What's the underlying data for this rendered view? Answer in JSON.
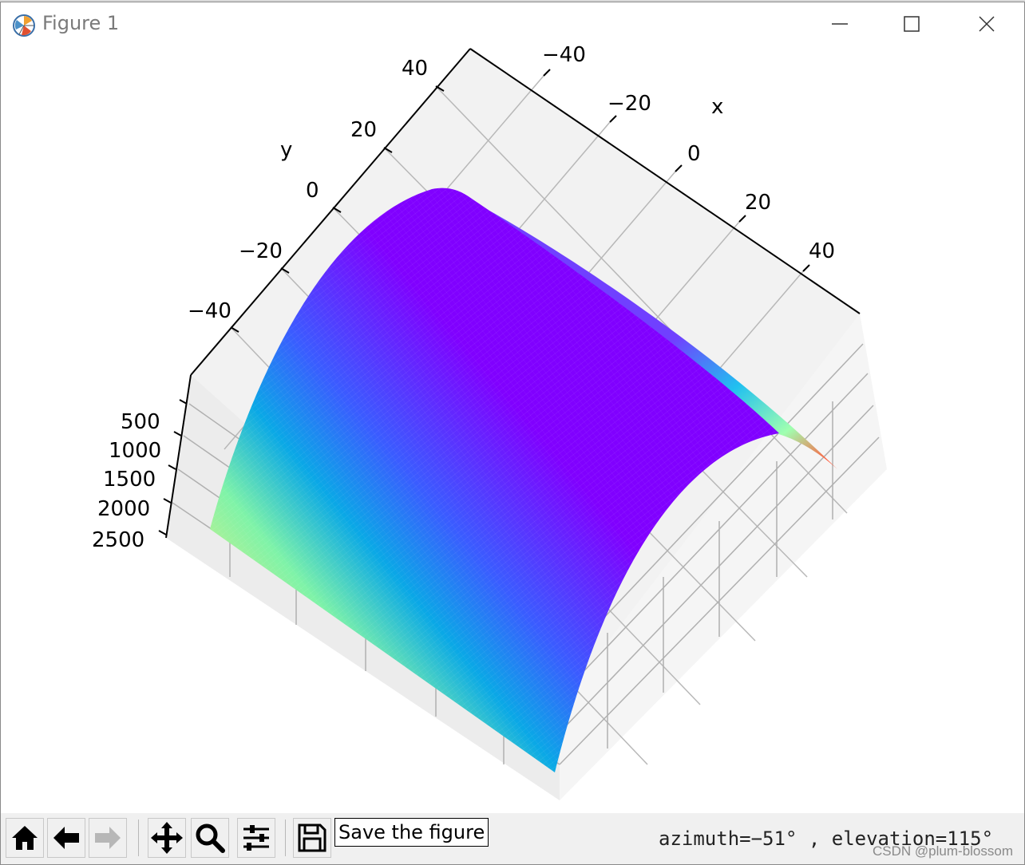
{
  "window": {
    "title": "Figure 1",
    "controls": [
      "minimize",
      "maximize",
      "close"
    ]
  },
  "plot": {
    "x_axis_label": "x",
    "y_axis_label": "y",
    "x_ticks": [
      "−40",
      "−20",
      "0",
      "20",
      "40"
    ],
    "y_ticks": [
      "40",
      "20",
      "0",
      "−20",
      "−40"
    ],
    "z_ticks": [
      "500",
      "1000",
      "1500",
      "2000",
      "2500"
    ],
    "colormap": "rainbow",
    "colors": {
      "pane": "#f2f2f2",
      "grid": "#b0b0b0",
      "surface_low": "#8000ff",
      "surface_high": "#ff0000"
    }
  },
  "chart_data": {
    "type": "surface",
    "xlabel": "x",
    "ylabel": "y",
    "zlabel": "",
    "xlim": [
      -50,
      50
    ],
    "ylim": [
      -50,
      50
    ],
    "zlim": [
      0,
      2500
    ],
    "x_ticks": [
      -40,
      -20,
      0,
      20,
      40
    ],
    "y_ticks": [
      -40,
      -20,
      0,
      20,
      40
    ],
    "z_ticks": [
      500,
      1000,
      1500,
      2000,
      2500
    ],
    "view": {
      "azimuth": -51,
      "elevation": 115
    },
    "grid": true,
    "colormap": "rainbow"
  },
  "toolbar": {
    "buttons": [
      {
        "name": "home-button",
        "icon": "home-icon"
      },
      {
        "name": "back-button",
        "icon": "arrow-left-icon"
      },
      {
        "name": "forward-button",
        "icon": "arrow-right-icon"
      },
      {
        "name": "pan-button",
        "icon": "move-icon"
      },
      {
        "name": "zoom-button",
        "icon": "magnifier-icon"
      },
      {
        "name": "configure-subplots-button",
        "icon": "sliders-icon"
      },
      {
        "name": "save-button",
        "icon": "floppy-disk-icon"
      }
    ],
    "tooltip": "Save the figure",
    "status": "azimuth=−51° , elevation=115°"
  },
  "watermark": "CSDN @plum-blossom"
}
